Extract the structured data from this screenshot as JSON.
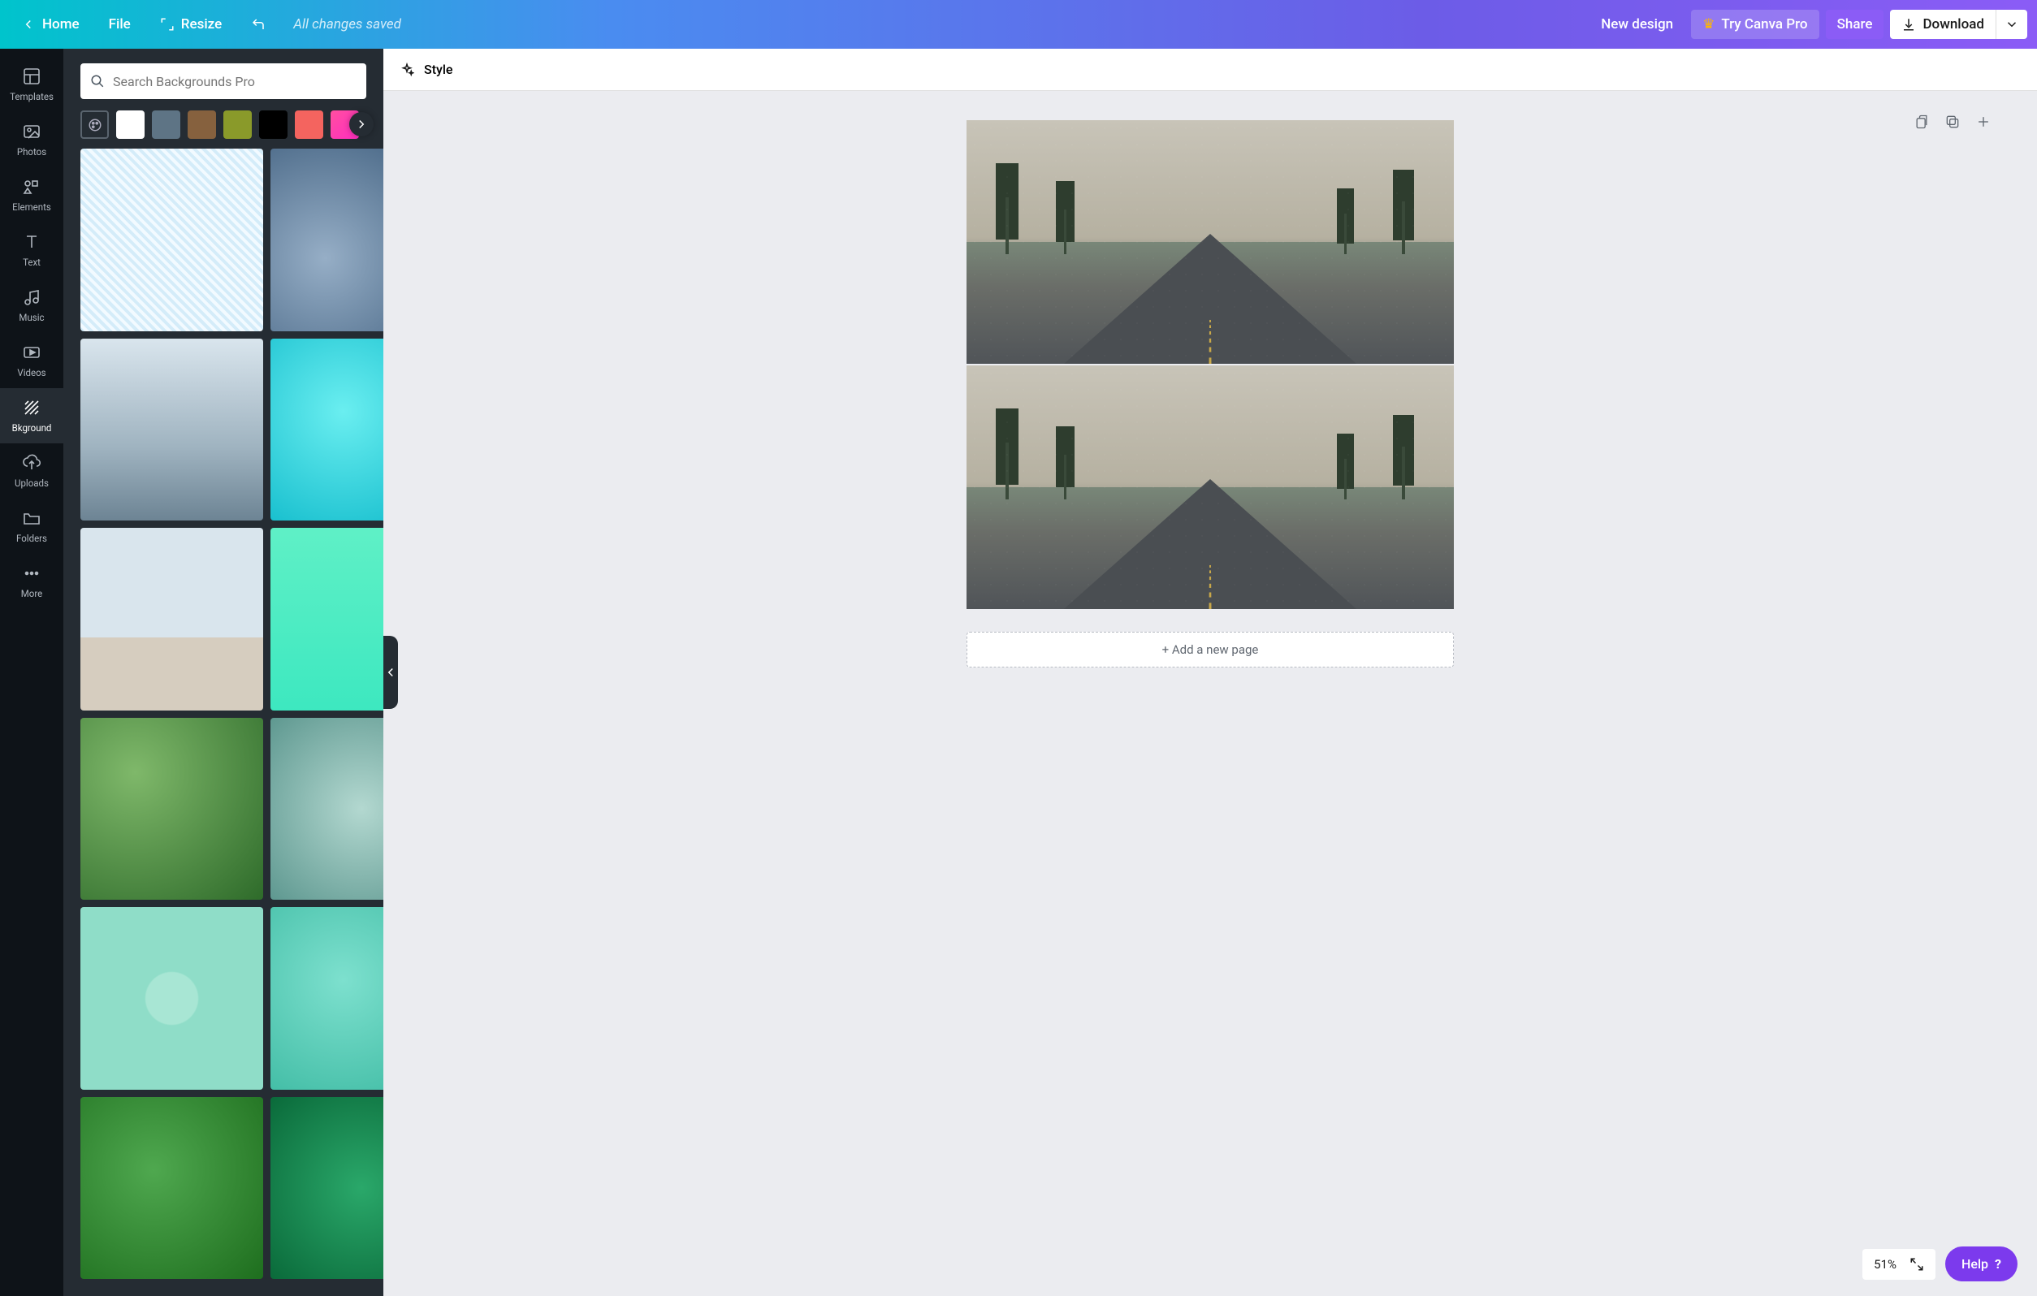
{
  "topbar": {
    "home": "Home",
    "file": "File",
    "resize": "Resize",
    "status": "All changes saved",
    "new_design": "New design",
    "try_pro": "Try Canva Pro",
    "share": "Share",
    "download": "Download"
  },
  "rail": {
    "items": [
      {
        "id": "templates",
        "label": "Templates"
      },
      {
        "id": "photos",
        "label": "Photos"
      },
      {
        "id": "elements",
        "label": "Elements"
      },
      {
        "id": "text",
        "label": "Text"
      },
      {
        "id": "music",
        "label": "Music"
      },
      {
        "id": "videos",
        "label": "Videos"
      },
      {
        "id": "bkground",
        "label": "Bkground",
        "active": true
      },
      {
        "id": "uploads",
        "label": "Uploads"
      },
      {
        "id": "folders",
        "label": "Folders"
      },
      {
        "id": "more",
        "label": "More"
      }
    ]
  },
  "panel": {
    "search_placeholder": "Search Backgrounds Pro",
    "colors": [
      {
        "id": "palette",
        "css": "transparent"
      },
      {
        "id": "white",
        "css": "#ffffff"
      },
      {
        "id": "slate",
        "css": "#5e7485"
      },
      {
        "id": "brown",
        "css": "#86613e"
      },
      {
        "id": "olive",
        "css": "#8a9a2a"
      },
      {
        "id": "black",
        "css": "#000000"
      },
      {
        "id": "coral",
        "css": "#f4645f"
      },
      {
        "id": "magenta",
        "css": "linear-gradient(135deg,#ff4fa0,#ff2dc0)"
      }
    ],
    "thumbs": [
      {
        "id": "diag-light-blue",
        "css": "repeating-linear-gradient(45deg,#d4ecf9 0 4px,#f2faff 4px 8px)"
      },
      {
        "id": "rain-bokeh",
        "css": "radial-gradient(circle at 30% 60%,#96aec6,#3a5a7a)"
      },
      {
        "id": "blue-mountains",
        "css": "linear-gradient(#cfe6f5,#7ea3c5 70%,#2a3d52)"
      },
      {
        "id": "misty-mountains",
        "css": "linear-gradient(#d9e5ed,#9fb3c0 60%,#6d8494)"
      },
      {
        "id": "pool-water",
        "css": "radial-gradient(circle at 40% 40%,#6aeef0,#0bb8c9)"
      },
      {
        "id": "mint-pattern",
        "css": "repeating-linear-gradient(45deg,#b6ecd5 0 6px,#d6f6e6 6px 12px)"
      },
      {
        "id": "beach-pale",
        "css": "linear-gradient(#d9e5ed 0 60%,#d6cdbf 60% 100%)"
      },
      {
        "id": "mint-gradient",
        "css": "linear-gradient(#5ff0c6,#3de8c0)"
      },
      {
        "id": "beach-aerial",
        "css": "linear-gradient(135deg,#e3d6be 0 40%,#2d8a78 40% 100%)"
      },
      {
        "id": "green-leaves",
        "css": "radial-gradient(circle at 30% 30%,#7fb86a,#2e6b2a)"
      },
      {
        "id": "sea-foam",
        "css": "radial-gradient(circle at 50% 50%,#b3d8d0,#5e9890)"
      },
      {
        "id": "fern",
        "css": "radial-gradient(circle at 50% 50%,#6a7668,#3c4a3a)"
      },
      {
        "id": "mint-dots",
        "css": "radial-gradient(#a8e6d4 20%, #8fddc8 21%)"
      },
      {
        "id": "clear-water",
        "css": "radial-gradient(circle at 40% 40%,#7de0ce,#3ab8a0)"
      },
      {
        "id": "cyan-diag",
        "css": "repeating-linear-gradient(45deg,#1ed8d8 0 4px,#35e3e3 4px 8px)"
      },
      {
        "id": "big-leaves",
        "css": "radial-gradient(circle at 40% 40%,#4fa84f,#1e6e1e)"
      },
      {
        "id": "green-jellyfish",
        "css": "radial-gradient(circle at 50% 50%,#2aa86a,#0a6a3a)"
      },
      {
        "id": "aurora",
        "css": "linear-gradient(135deg,#1a6e3e,#6eff9d 50%,#0a3a1a)"
      }
    ]
  },
  "context_bar": {
    "style": "Style"
  },
  "canvas": {
    "add_page": "+ Add a new page",
    "zoom": "51%",
    "help": "Help"
  }
}
